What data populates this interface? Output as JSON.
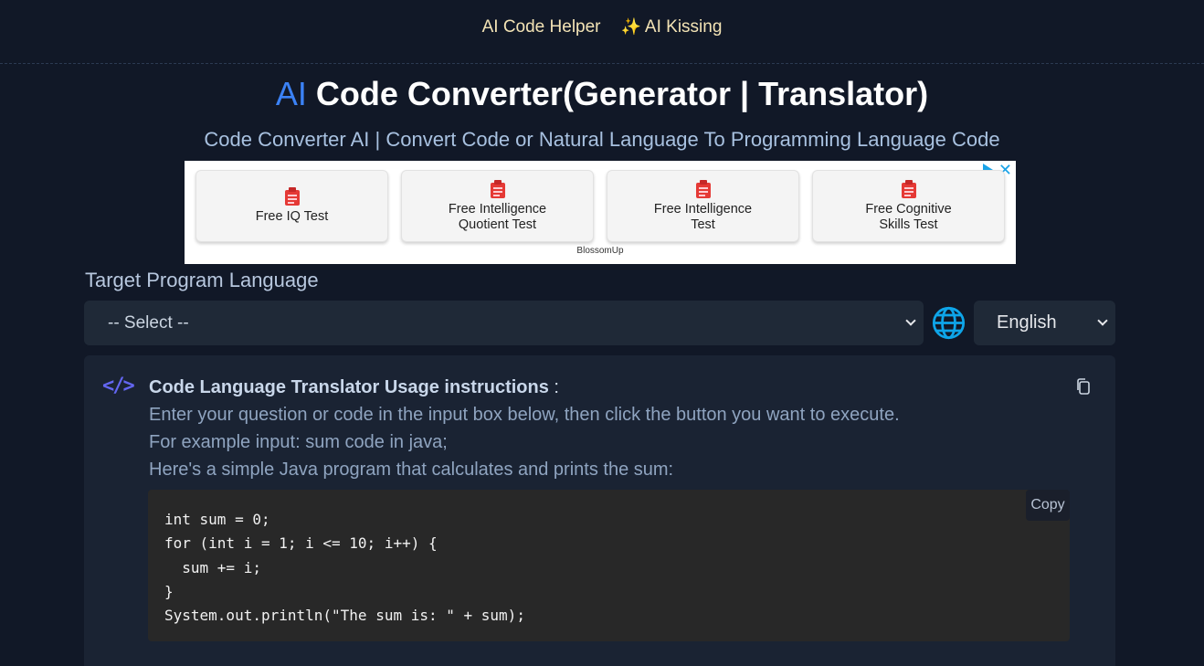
{
  "nav": {
    "items": [
      {
        "label": "AI Code Helper"
      },
      {
        "label": "AI Kissing",
        "icon": "sparkle-icon"
      }
    ]
  },
  "header": {
    "title_ai": "AI",
    "title_rest": " Code Converter(Generator | Translator)",
    "subtitle": "Code Converter AI | Convert Code or Natural Language To Programming Language Code"
  },
  "ad": {
    "cards": [
      {
        "line1": "Free IQ Test",
        "line2": ""
      },
      {
        "line1": "Free Intelligence",
        "line2": "Quotient Test"
      },
      {
        "line1": "Free Intelligence",
        "line2": "Test"
      },
      {
        "line1": "Free Cognitive",
        "line2": "Skills Test"
      }
    ],
    "sponsor": "BlossomUp"
  },
  "target": {
    "label": "Target Program Language",
    "select_value": "-- Select --",
    "language_value": "English"
  },
  "instructions": {
    "title": "Code Language Translator Usage instructions",
    "title_suffix": " :",
    "line1": "Enter your question or code in the input box below, then click the button you want to execute.",
    "line2": "For example input: sum code in java;",
    "line3": "Here's a simple Java program that calculates and prints the sum:",
    "copy_label": "Copy",
    "code": "int sum = 0;\nfor (int i = 1; i <= 10; i++) {\n  sum += i;\n}\nSystem.out.println(\"The sum is: \" + sum);"
  },
  "colors": {
    "background": "#111827",
    "accent": "#3b82f6",
    "code_icon": "#6366f1",
    "globe": "#0ea5e9"
  }
}
